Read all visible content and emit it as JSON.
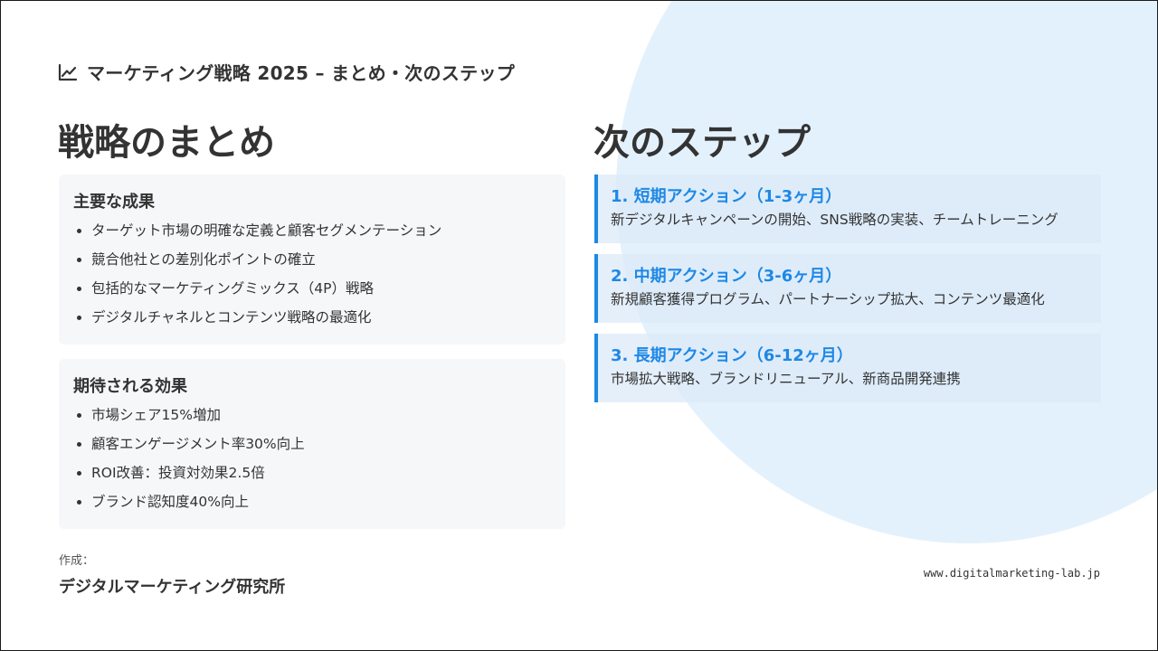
{
  "header": {
    "icon": "line-chart-icon",
    "title": "マーケティング戦略 2025 – まとめ・次のステップ"
  },
  "summary": {
    "heading": "戦略のまとめ",
    "achievements": {
      "title": "主要な成果",
      "items": [
        "ターゲット市場の明確な定義と顧客セグメンテーション",
        "競合他社との差別化ポイントの確立",
        "包括的なマーケティングミックス（4P）戦略",
        "デジタルチャネルとコンテンツ戦略の最適化"
      ]
    },
    "effects": {
      "title": "期待される効果",
      "items": [
        "市場シェア15%増加",
        "顧客エンゲージメント率30%向上",
        "ROI改善：投資対効果2.5倍",
        "ブランド認知度40%向上"
      ]
    }
  },
  "next_steps": {
    "heading": "次のステップ",
    "steps": [
      {
        "title": "1. 短期アクション（1-3ヶ月）",
        "desc": "新デジタルキャンペーンの開始、SNS戦略の実装、チームトレーニング"
      },
      {
        "title": "2. 中期アクション（3-6ヶ月）",
        "desc": "新規顧客獲得プログラム、パートナーシップ拡大、コンテンツ最適化"
      },
      {
        "title": "3. 長期アクション（6-12ヶ月）",
        "desc": "市場拡大戦略、ブランドリニューアル、新商品開発連携"
      }
    ]
  },
  "footer": {
    "author_label": "作成：",
    "author_name": "デジタルマーケティング研究所",
    "website": "www.digitalmarketing-lab.jp"
  },
  "colors": {
    "accent": "#1e88e5",
    "background_circle": "#e3f1fd",
    "card_background": "#f6f7f9",
    "text": "#333333"
  }
}
